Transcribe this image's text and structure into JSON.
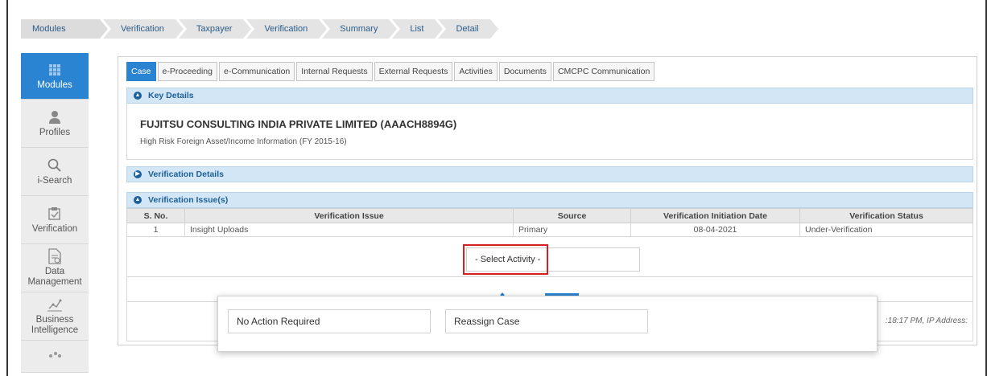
{
  "breadcrumb": [
    "Modules",
    "Verification",
    "Taxpayer",
    "Verification",
    "Summary",
    "List",
    "Detail"
  ],
  "sidebar": [
    {
      "label": "Modules",
      "icon": "grid-icon",
      "active": true
    },
    {
      "label": "Profiles",
      "icon": "user-icon"
    },
    {
      "label": "i-Search",
      "icon": "search-icon"
    },
    {
      "label": "Verification",
      "icon": "verification-icon"
    },
    {
      "label": "Data Management",
      "icon": "document-icon"
    },
    {
      "label": "Business Intelligence",
      "icon": "chart-icon"
    }
  ],
  "tabs": [
    "Case",
    "e-Proceeding",
    "e-Communication",
    "Internal Requests",
    "External Requests",
    "Activities",
    "Documents",
    "CMCPC Communication"
  ],
  "key_details": {
    "header": "Key Details",
    "company": "FUJITSU CONSULTING INDIA PRIVATE LIMITED  (AAACH8894G)",
    "subtitle": "High Risk Foreign Asset/Income Information (FY 2015-16)"
  },
  "verification_details": {
    "header": "Verification Details"
  },
  "verification_issues": {
    "header": "Verification Issue(s)",
    "columns": [
      "S. No.",
      "Verification Issue",
      "Source",
      "Verification Initiation Date",
      "Verification Status"
    ],
    "rows": [
      [
        "1",
        "Insight Uploads",
        "Primary",
        "08-04-2021",
        "Under-Verification"
      ]
    ]
  },
  "select_activity": {
    "value": "- Select Activity -"
  },
  "footer_text": ":18:17 PM, IP Address:",
  "dropdown": {
    "options": [
      "No Action Required",
      "Reassign Case"
    ]
  },
  "colors": {
    "accent": "#2b84d1",
    "highlight": "#d42020",
    "section_bg": "#d3e6f5"
  }
}
